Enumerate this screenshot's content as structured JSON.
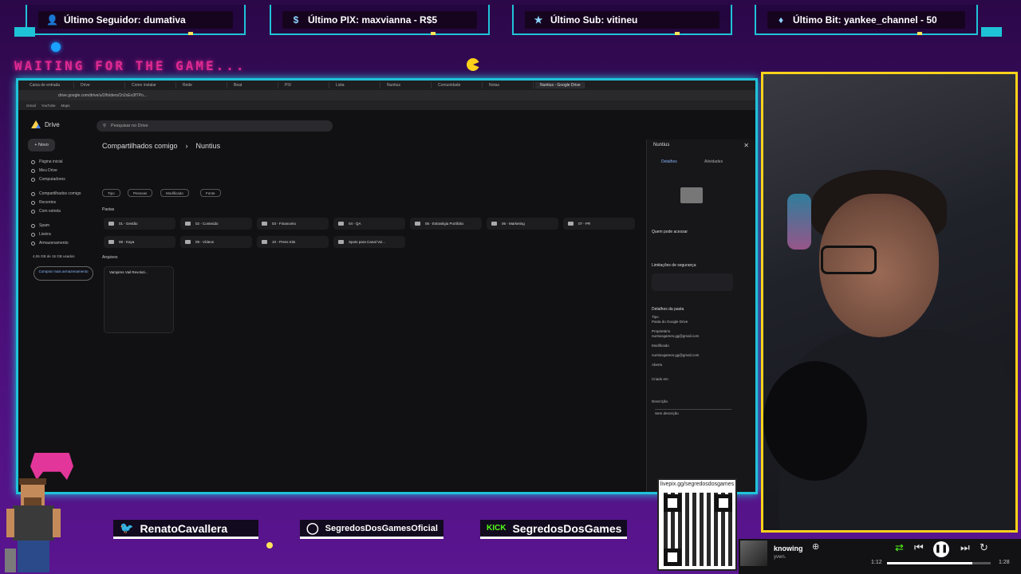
{
  "banners": [
    {
      "icon": "user-icon",
      "text": "Último Seguidor: dumativa"
    },
    {
      "icon": "dollar-icon",
      "text": "Último PIX: maxvianna - R$5"
    },
    {
      "icon": "star-icon",
      "text": "Último Sub: vitineu"
    },
    {
      "icon": "diamond-icon",
      "text": "Último Bit: yankee_channel - 50"
    }
  ],
  "waiting_text": "WAITING FOR THE GAME...",
  "browser": {
    "tabs": [
      "Caixa de entrada",
      "Drive",
      "Como instalar",
      "Rede",
      "Beat",
      "PIX",
      "Lista",
      "Nuntius",
      "Comunidade",
      "Notas",
      "Nuntius - Google Drive"
    ],
    "active_tab": 10,
    "url": "drive.google.com/drive/u/2/folders/1h2xEo3fTPo..."
  },
  "drive": {
    "app_name": "Drive",
    "search_placeholder": "Pesquisar no Drive",
    "new_label": "Novo",
    "nav": [
      "Página inicial",
      "Meu Drive",
      "Computadores",
      "Compartilhados comigo",
      "Recentes",
      "Com estrela",
      "Spam",
      "Lixeira",
      "Armazenamento"
    ],
    "storage_text": "4,06 GB de 15 GB usados",
    "buy_storage": "Comprar mais armazenamento",
    "breadcrumb": [
      "Compartilhados comigo",
      "Nuntius"
    ],
    "filters": [
      "Tipo",
      "Pessoas",
      "Modificado",
      "Fonte"
    ],
    "sections": {
      "folders": "Pastas",
      "files": "Arquivos"
    },
    "folders": [
      "01 - Gestão",
      "02 - Conteúdo",
      "03 - Financeiro",
      "04 - QA",
      "05 - Estratégia Portifolio",
      "06 - Marketing",
      "07 - PR",
      "08 - Kaya",
      "09 - Vídeos",
      "10 - Press Kits",
      "Spots para Canal Voi..."
    ],
    "files": [
      "Vampires Vail Revoluti..."
    ],
    "panel": {
      "title": "Nuntius",
      "tabs": [
        "Detalhes",
        "Atividades"
      ],
      "access_heading": "Quem pode acessar",
      "security_heading": "Limitações de segurança",
      "details_heading": "Detalhes da pasta",
      "type_label": "Tipo",
      "type_value": "Pasta do Google Drive",
      "owner_label": "Proprietário",
      "owner_value": "nuntiusgames.gg@gmail.com",
      "modified_label": "Modificado",
      "modified_value": "nuntiusgames.gg@gmail.com",
      "opened_label": "Aberto",
      "created_label": "Criado em",
      "description_label": "Descrição",
      "description_placeholder": "Sem descrição"
    }
  },
  "socials": [
    {
      "icon": "twitter-icon",
      "text": "RenatoCavallera"
    },
    {
      "icon": "instagram-icon",
      "text": "SegredosDosGamesOficial"
    },
    {
      "icon": "kick-icon",
      "text": "SegredosDosGames"
    }
  ],
  "qr_label": "livepix.gg/segredosdosgames",
  "player": {
    "song": "knowing",
    "artist": "yvwn.",
    "elapsed": "1:12",
    "duration": "1:28",
    "progress": 0.82
  }
}
